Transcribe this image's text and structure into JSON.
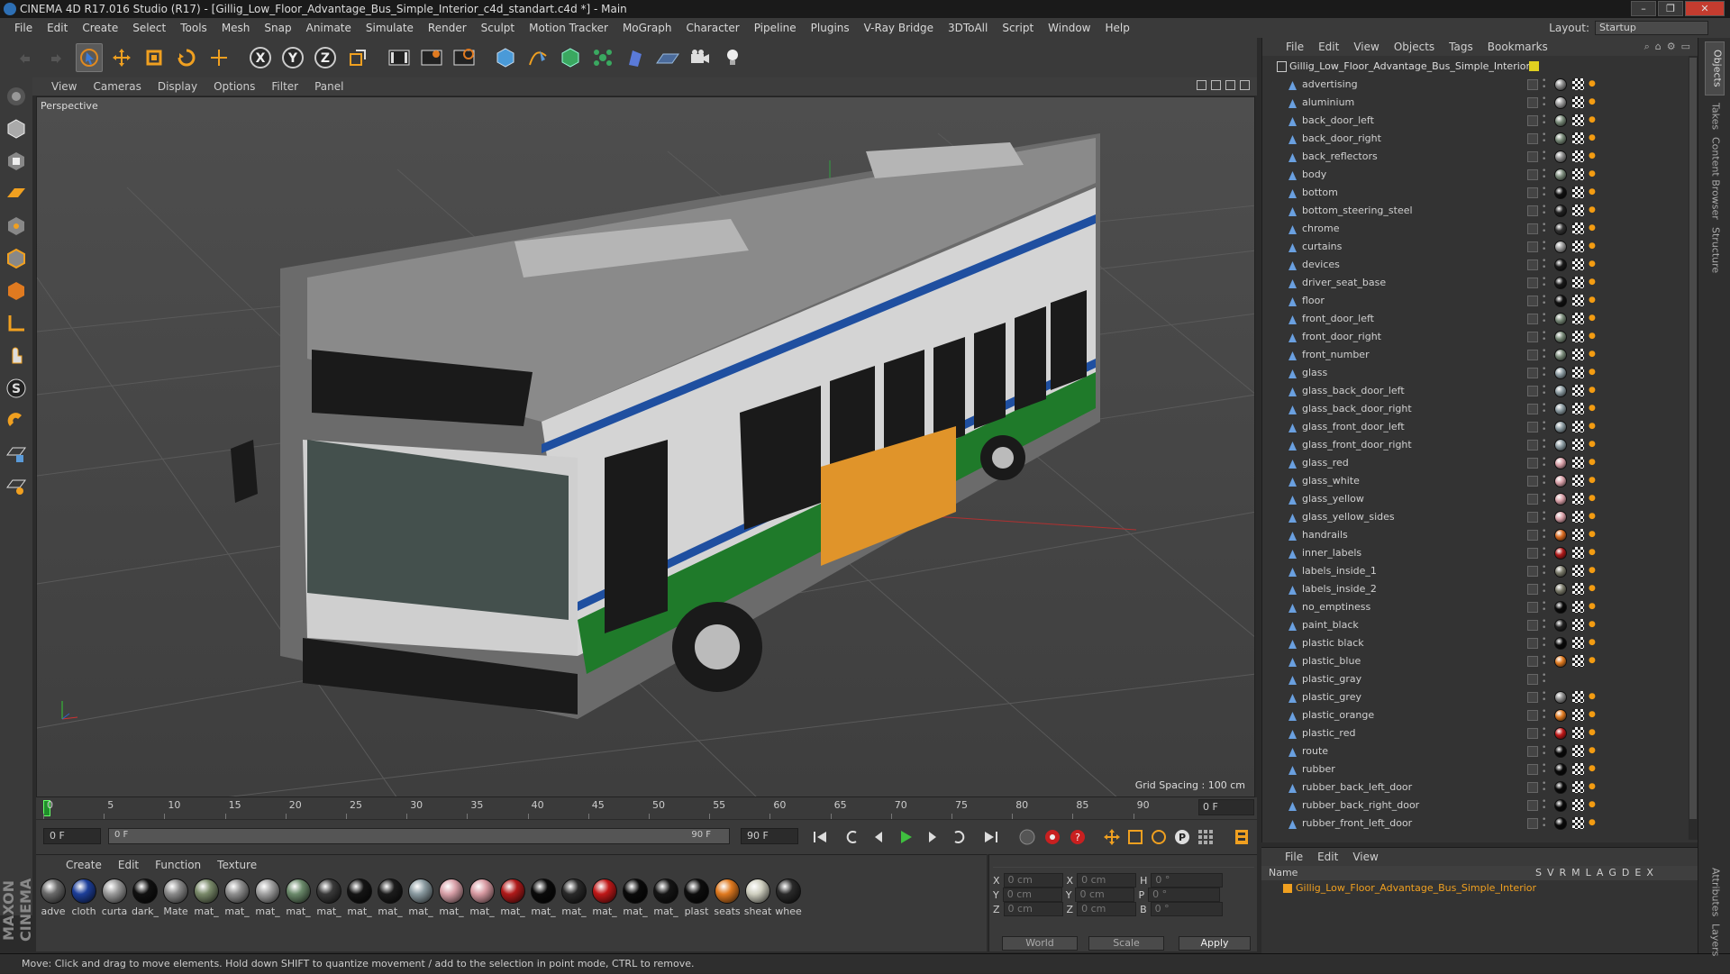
{
  "window": {
    "title": "CINEMA 4D R17.016 Studio (R17) - [Gillig_Low_Floor_Advantage_Bus_Simple_Interior_c4d_standart.c4d *] - Main"
  },
  "menu": [
    "File",
    "Edit",
    "Create",
    "Select",
    "Tools",
    "Mesh",
    "Snap",
    "Animate",
    "Simulate",
    "Render",
    "Sculpt",
    "Motion Tracker",
    "MoGraph",
    "Character",
    "Pipeline",
    "Plugins",
    "V-Ray Bridge",
    "3DToAll",
    "Script",
    "Window",
    "Help"
  ],
  "layout": {
    "label": "Layout:",
    "value": "Startup"
  },
  "toolbar_icons": [
    "undo-icon",
    "redo-icon",
    "select-icon",
    "move-icon",
    "scale-icon",
    "rotate-icon",
    "add-icon",
    "x-axis-icon",
    "y-axis-icon",
    "z-axis-icon",
    "coord-system-icon",
    "render-view-icon",
    "render-picture-viewer-icon",
    "render-settings-icon",
    "cube-icon",
    "pen-icon",
    "subdivision-icon",
    "array-icon",
    "deformer-icon",
    "floor-icon",
    "camera-icon",
    "light-icon"
  ],
  "viewport_menu": [
    "View",
    "Cameras",
    "Display",
    "Options",
    "Filter",
    "Panel"
  ],
  "viewport": {
    "label": "Perspective",
    "grid_spacing": "Grid Spacing : 100 cm"
  },
  "timeline": {
    "ticks": [
      "0",
      "5",
      "10",
      "15",
      "20",
      "25",
      "30",
      "35",
      "40",
      "45",
      "50",
      "55",
      "60",
      "65",
      "70",
      "75",
      "80",
      "85",
      "90"
    ],
    "current": "0 F"
  },
  "transport": {
    "start": "0 F",
    "slider_left": "0 F",
    "slider_right": "90 F",
    "end": "90 F"
  },
  "material_menu": [
    "Create",
    "Edit",
    "Function",
    "Texture"
  ],
  "materials": [
    {
      "name": "adve",
      "color": "#6a6a6a"
    },
    {
      "name": "cloth",
      "color": "#1d3f9a"
    },
    {
      "name": "curta",
      "color": "#9a9a9a"
    },
    {
      "name": "dark_",
      "color": "#111111"
    },
    {
      "name": "Mate",
      "color": "#8a8a8a"
    },
    {
      "name": "mat_",
      "color": "#7a8a6a"
    },
    {
      "name": "mat_",
      "color": "#8f8f8f"
    },
    {
      "name": "mat_",
      "color": "#a0a0a0"
    },
    {
      "name": "mat_",
      "color": "#6b8a6b"
    },
    {
      "name": "mat_",
      "color": "#3a3a3a"
    },
    {
      "name": "mat_",
      "color": "#141414"
    },
    {
      "name": "mat_",
      "color": "#1c1c1c"
    },
    {
      "name": "mat_",
      "color": "#8a9aa0"
    },
    {
      "name": "mat_",
      "color": "#d8a0a8"
    },
    {
      "name": "mat_",
      "color": "#d89aa2"
    },
    {
      "name": "mat_",
      "color": "#b01a1a"
    },
    {
      "name": "mat_",
      "color": "#0a0a0a"
    },
    {
      "name": "mat_",
      "color": "#2a2a2a"
    },
    {
      "name": "mat_",
      "color": "#c01818"
    },
    {
      "name": "mat_",
      "color": "#0a0a0a"
    },
    {
      "name": "mat_",
      "color": "#151515"
    },
    {
      "name": "plast",
      "color": "#0d0d0d"
    },
    {
      "name": "seats",
      "color": "#e07a20"
    },
    {
      "name": "sheat",
      "color": "#cfcfc0"
    },
    {
      "name": "whee",
      "color": "#2a2a2a"
    }
  ],
  "coords": {
    "rows": [
      {
        "a": "X",
        "av": "0 cm",
        "b": "X",
        "bv": "0 cm",
        "c": "H",
        "cv": "0 °"
      },
      {
        "a": "Y",
        "av": "0 cm",
        "b": "Y",
        "bv": "0 cm",
        "c": "P",
        "cv": "0 °"
      },
      {
        "a": "Z",
        "av": "0 cm",
        "b": "Z",
        "bv": "0 cm",
        "c": "B",
        "cv": "0 °"
      }
    ],
    "world": "World",
    "scale": "Scale",
    "apply": "Apply"
  },
  "status": "Move: Click and drag to move elements. Hold down SHIFT to quantize movement / add to the selection in point mode, CTRL to remove.",
  "object_menu": [
    "File",
    "Edit",
    "View",
    "Objects",
    "Tags",
    "Bookmarks"
  ],
  "objects": {
    "root": "Gillig_Low_Floor_Advantage_Bus_Simple_Interior",
    "items": [
      {
        "name": "advertising",
        "tag": "#888888"
      },
      {
        "name": "aluminium",
        "tag": "#999999"
      },
      {
        "name": "back_door_left",
        "tag": "#778877"
      },
      {
        "name": "back_door_right",
        "tag": "#778877"
      },
      {
        "name": "back_reflectors",
        "tag": "#8a8a8a"
      },
      {
        "name": "body",
        "tag": "#7a8a7a"
      },
      {
        "name": "bottom",
        "tag": "#111111"
      },
      {
        "name": "bottom_steering_steel",
        "tag": "#222222"
      },
      {
        "name": "chrome",
        "tag": "#333333"
      },
      {
        "name": "curtains",
        "tag": "#999999"
      },
      {
        "name": "devices",
        "tag": "#1a1a1a"
      },
      {
        "name": "driver_seat_base",
        "tag": "#1a1a1a"
      },
      {
        "name": "floor",
        "tag": "#111111"
      },
      {
        "name": "front_door_left",
        "tag": "#778877"
      },
      {
        "name": "front_door_right",
        "tag": "#778877"
      },
      {
        "name": "front_number",
        "tag": "#778877"
      },
      {
        "name": "glass",
        "tag": "#8a9aa0"
      },
      {
        "name": "glass_back_door_left",
        "tag": "#8a9aa0"
      },
      {
        "name": "glass_back_door_right",
        "tag": "#8a9aa0"
      },
      {
        "name": "glass_front_door_left",
        "tag": "#8a9aa0"
      },
      {
        "name": "glass_front_door_right",
        "tag": "#8a9aa0"
      },
      {
        "name": "glass_red",
        "tag": "#d8a0a8"
      },
      {
        "name": "glass_white",
        "tag": "#d8a0a8"
      },
      {
        "name": "glass_yellow",
        "tag": "#d8a0a8"
      },
      {
        "name": "glass_yellow_sides",
        "tag": "#d8a0a8"
      },
      {
        "name": "handrails",
        "tag": "#d86a20"
      },
      {
        "name": "inner_labels",
        "tag": "#b01a1a"
      },
      {
        "name": "labels_inside_1",
        "tag": "#7a7a6a"
      },
      {
        "name": "labels_inside_2",
        "tag": "#7a7a6a"
      },
      {
        "name": "no_emptiness",
        "tag": "#0a0a0a"
      },
      {
        "name": "paint_black",
        "tag": "#222222"
      },
      {
        "name": "plastic black",
        "tag": "#0a0a0a"
      },
      {
        "name": "plastic_blue",
        "tag": "#e07a20"
      },
      {
        "name": "plastic_gray",
        "tag": ""
      },
      {
        "name": "plastic_grey",
        "tag": "#8a8a8a"
      },
      {
        "name": "plastic_orange",
        "tag": "#e07a20"
      },
      {
        "name": "plastic_red",
        "tag": "#c01818"
      },
      {
        "name": "route",
        "tag": "#0a0a0a"
      },
      {
        "name": "rubber",
        "tag": "#0a0a0a"
      },
      {
        "name": "rubber_back_left_door",
        "tag": "#0a0a0a"
      },
      {
        "name": "rubber_back_right_door",
        "tag": "#0a0a0a"
      },
      {
        "name": "rubber_front_left_door",
        "tag": "#0a0a0a"
      }
    ]
  },
  "side_tabs": [
    "Objects",
    "Takes",
    "Content Browser",
    "Structure"
  ],
  "layer_menu": [
    "File",
    "Edit",
    "View"
  ],
  "layers": {
    "header_name": "Name",
    "cols": [
      "S",
      "V",
      "R",
      "M",
      "L",
      "A",
      "G",
      "D",
      "E",
      "X"
    ],
    "row": "Gillig_Low_Floor_Advantage_Bus_Simple_Interior"
  },
  "side_tabs_bottom": [
    "Attributes",
    "Layers"
  ],
  "colors": {
    "accent": "#f0a020",
    "playhead": "#1f8f2a",
    "bus_green": "#1f7a2a",
    "bus_blue": "#1f4fa0"
  }
}
